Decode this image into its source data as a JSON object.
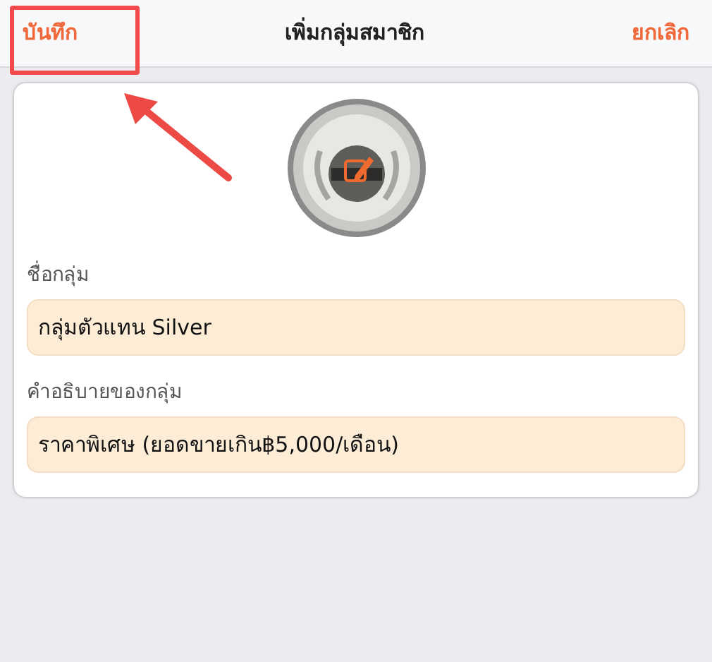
{
  "nav_bar": {
    "save": "บันทึก",
    "title": "เพิ่มกลุ่มสมาชิก",
    "cancel": "ยกเลิก"
  },
  "form": {
    "fields": [
      {
        "label": "ชื่อกลุ่ม",
        "value": "กลุ่มตัวแทน Silver"
      },
      {
        "label": "คำอธิบายของกลุ่ม",
        "value": "ราคาพิเศษ (ยอดขายเกิน฿5,000/เดือน)"
      }
    ]
  }
}
